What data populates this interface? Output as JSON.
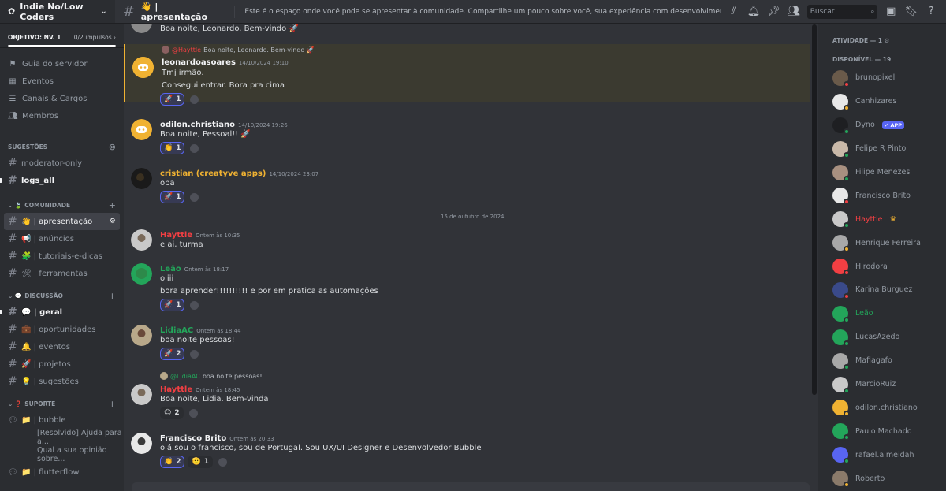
{
  "server": {
    "name": "Indie No/Low Coders"
  },
  "channel": {
    "name": "👋 | apresentação",
    "topic": "Este é o espaço onde você pode se apresentar à comunidade. Compartilhe um pouco sobre você, sua experiência com desenvolvimento no-code e low-code,..."
  },
  "search": {
    "placeholder": "Buscar"
  },
  "goal": {
    "label": "OBJETIVO: NV. 1",
    "progress": "0/2 impulsos"
  },
  "nav": [
    "Guia do servidor",
    "Eventos",
    "Canais & Cargos",
    "Membros"
  ],
  "categories": {
    "sugestoes": "SUGESTÕES",
    "comunidade": "COMUNIDADE",
    "discussao": "DISCUSSÃO",
    "suporte": "SUPORTE"
  },
  "channels": {
    "moderator": "moderator-only",
    "logs": "logs_all",
    "apresentacao": "👋 | apresentação",
    "anuncios": "📢 | anúncios",
    "tutoriais": "🧩 | tutoriais-e-dicas",
    "ferramentas": "🛠 | ferramentas",
    "geral": "💬 | geral",
    "oportunidades": "💼 | oportunidades",
    "eventos": "🔔 | eventos",
    "projetos": "🚀 | projetos",
    "sugestoes": "💡 | sugestões",
    "bubble": "📁 | bubble",
    "thread1": "[Resolvido] Ajuda para a...",
    "thread2": "Qual a sua opinião sobre...",
    "flutterflow": "📁 | flutterflow"
  },
  "messages": [
    {
      "text": "Boa noite, Leonardo. Bem-vindo 🚀"
    },
    {
      "reply_user": "@Hayttle",
      "reply_text": "Boa noite, Leonardo. Bem-vindo 🚀",
      "user": "leonardoasoares",
      "time": "14/10/2024 19:10",
      "lines": [
        "Tmj irmão.",
        "Consegui entrar. Bora pra cima"
      ],
      "reacts": [
        {
          "e": "🚀",
          "n": "1"
        }
      ]
    },
    {
      "user": "odilon.christiano",
      "time": "14/10/2024 19:26",
      "lines": [
        "Boa noite, Pessoal!! 🚀"
      ],
      "reacts": [
        {
          "e": "👏",
          "n": "1"
        }
      ]
    },
    {
      "user": "cristian (creatyve apps)",
      "time": "14/10/2024 23:07",
      "lines": [
        "opa"
      ],
      "reacts": [
        {
          "e": "🚀",
          "n": "1"
        }
      ]
    },
    {
      "divider": "15 de outubro de 2024"
    },
    {
      "user": "Hayttle",
      "time": "Ontem às 10:35",
      "lines": [
        "e ai, turma"
      ]
    },
    {
      "user": "Leão",
      "time": "Ontem às 18:17",
      "lines": [
        "oiiii",
        "bora aprender!!!!!!!!!! e por em pratica as automações"
      ],
      "reacts": [
        {
          "e": "🚀",
          "n": "1"
        }
      ]
    },
    {
      "user": "LidiaAC",
      "time": "Ontem às 18:44",
      "lines": [
        "boa noite pessoas!"
      ],
      "reacts": [
        {
          "e": "🚀",
          "n": "2"
        }
      ]
    },
    {
      "reply_user": "@LidiaAC",
      "reply_text": "boa noite pessoas!",
      "user": "Hayttle",
      "time": "Ontem às 18:45",
      "lines": [
        "Boa noite, Lidia. Bem-vinda"
      ],
      "reacts": [
        {
          "e": "😊",
          "n": "2"
        }
      ]
    },
    {
      "user": "Francisco Brito",
      "time": "Ontem às 20:33",
      "lines": [
        "olá sou o francisco, sou de Portugal. Sou UX/UI Designer e Desenvolvedor Bubble"
      ],
      "reacts": [
        {
          "e": "👏",
          "n": "2"
        },
        {
          "e": "🫡",
          "n": "1"
        }
      ]
    }
  ],
  "members": {
    "activity": "ATIVIDADE — 1",
    "online": "DISPONÍVEL — 19",
    "list": [
      "brunopixel",
      "Canhizares",
      "Dyno",
      "Felipe R Pinto",
      "Filipe Menezes",
      "Francisco Brito",
      "Hayttle",
      "Henrique Ferreira",
      "Hirodora",
      "Karina Burguez",
      "Leão",
      "LucasAzedo",
      "Mafiagafo",
      "MarcioRuiz",
      "odilon.christiano",
      "Paulo Machado",
      "rafael.almeidah",
      "Roberto"
    ],
    "app_badge": "✓ APP"
  },
  "colors": {
    "brand": "#5865f2",
    "online": "#23a55a",
    "idle": "#f0b232",
    "dnd": "#f23f43",
    "hayttle": "#f23f43",
    "leao": "#23a55a",
    "cristian": "#f0b232"
  }
}
